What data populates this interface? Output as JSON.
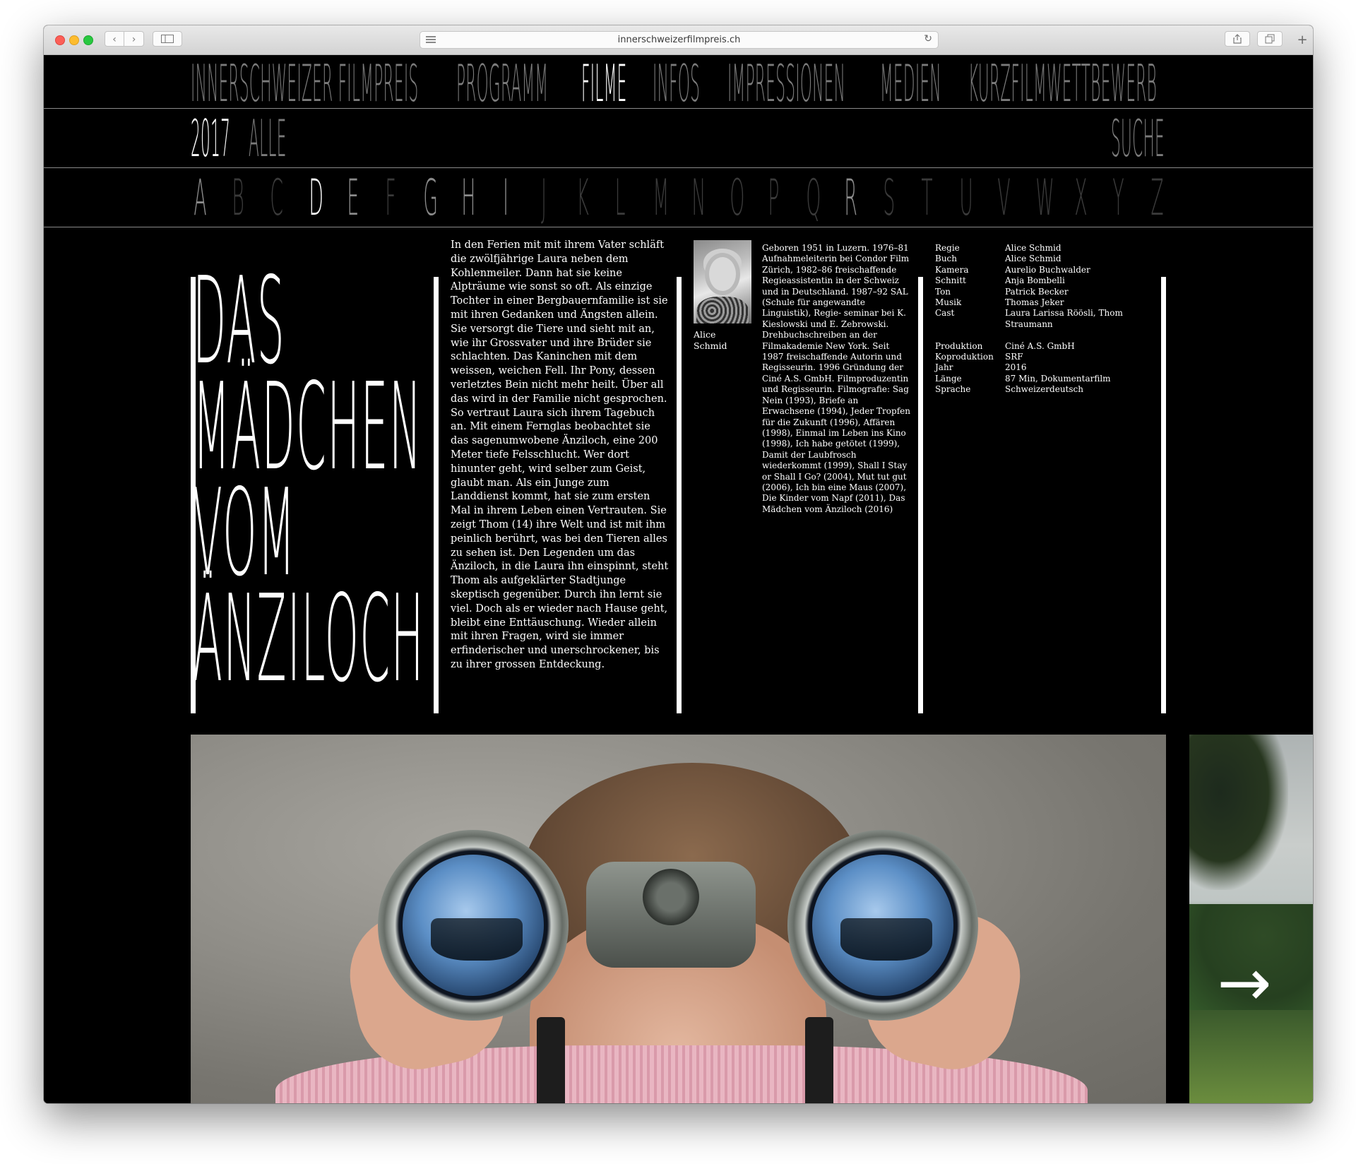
{
  "browser": {
    "url": "innerschweizerfilmpreis.ch",
    "back_icon": "chevron-left-icon",
    "forward_icon": "chevron-right-icon",
    "new_tab_label": "+"
  },
  "nav": {
    "items": [
      {
        "label": "INNERSCHWEIZER FILMPREIS",
        "active": false
      },
      {
        "label": "PROGRAMM",
        "active": false
      },
      {
        "label": "FILME",
        "active": true
      },
      {
        "label": "INFOS",
        "active": false
      },
      {
        "label": "IMPRESSIONEN",
        "active": false
      },
      {
        "label": "MEDIEN",
        "active": false
      },
      {
        "label": "KURZFILMWETTBEWERB",
        "active": false
      }
    ],
    "filter_year": "2017",
    "filter_all": "ALLE",
    "search": "SUCHE"
  },
  "alphabet": {
    "letters": [
      "A",
      "B",
      "C",
      "D",
      "E",
      "F",
      "G",
      "H",
      "I",
      "J",
      "K",
      "L",
      "M",
      "N",
      "O",
      "P",
      "Q",
      "R",
      "S",
      "T",
      "U",
      "V",
      "W",
      "X",
      "Y",
      "Z"
    ],
    "active": "D",
    "available": [
      "A",
      "D",
      "E",
      "G",
      "H",
      "I",
      "R"
    ]
  },
  "film": {
    "title_lines": [
      "DAS",
      "MÄDCHEN",
      "VOM",
      "ÄNZILOCH"
    ],
    "synopsis": "In den Ferien mit mit ihrem Vater schläft die zwölfjährige Laura neben dem Kohlenmeiler. Dann hat sie keine Alpträume wie sonst so oft. Als einzige Tochter in einer Bergbauernfamilie ist sie mit ihren Gedanken und Ängsten allein. Sie versorgt die Tiere und sieht mit an, wie ihr Grossvater und ihre Brüder sie schlachten. Das Kaninchen mit dem weissen, weichen Fell. Ihr Pony, dessen verletztes Bein nicht mehr heilt. Über all das wird in der Familie nicht gesprochen. So vertraut Laura sich ihrem Tagebuch an. Mit einem Fernglas beobachtet sie das sagenumwobene Änziloch, eine 200 Meter tiefe Felsschlucht. Wer dort hinunter geht, wird selber zum Geist, glaubt man. Als ein Junge zum Landdienst kommt, hat sie zum ersten Mal in ihrem Leben einen Vertrauten. Sie zeigt Thom (14) ihre Welt und ist mit ihm peinlich berührt, was bei den Tieren alles zu sehen ist. Den Legenden um das Änziloch, in die Laura ihn einspinnt, steht Thom als aufgeklärter Stadtjunge skeptisch gegenüber. Durch ihn lernt sie viel. Doch als er wieder nach Hause geht, bleibt eine Enttäuschung. Wieder allein mit ihren Fragen, wird sie immer erfinderischer und unerschrockener, bis zu ihrer grossen Entdeckung.",
    "director_name": "Alice Schmid",
    "director_bio": "Geboren 1951 in Luzern. 1976–81 Aufnahmeleiterin bei Condor Film Zürich, 1982–86 freischaffende Regieassistentin in der Schweiz und in Deutschland. 1987–92 SAL (Schule für angewandte Linguistik), Regie- seminar bei K. Kieslowski und E. Zebrowski. Drehbuchschreiben an der Filmakademie New York. Seit 1987 freischaffende Autorin und Regisseurin. 1996 Gründung der Ciné A.S. GmbH. Filmproduzentin und Regisseurin. Filmografie: Sag Nein (1993), Briefe an Erwachsene (1994), Jeder Tropfen für die Zukunft (1996), Affären (1998), Einmal im Leben ins Kino (1998), Ich habe getötet (1999), Damit der Laubfrosch wiederkommt (1999), Shall I Stay or Shall I Go? (2004), Mut tut gut (2006), Ich bin eine Maus (2007), Die Kinder vom Napf (2011), Das Mädchen vom Änziloch (2016)",
    "credits": [
      {
        "key": "Regie",
        "value": "Alice Schmid"
      },
      {
        "key": "Buch",
        "value": "Alice Schmid"
      },
      {
        "key": "Kamera",
        "value": "Aurelio Buchwalder"
      },
      {
        "key": "Schnitt",
        "value": "Anja Bombelli"
      },
      {
        "key": "Ton",
        "value": "Patrick Becker"
      },
      {
        "key": "Musik",
        "value": "Thomas Jeker"
      },
      {
        "key": "Cast",
        "value": "Laura Larissa Röösli, Thom Straumann"
      }
    ],
    "production": [
      {
        "key": "Produktion",
        "value": "Ciné A.S. GmbH"
      },
      {
        "key": "Koproduktion",
        "value": "SRF"
      },
      {
        "key": "Jahr",
        "value": "2016"
      },
      {
        "key": "Länge",
        "value": "87 Min, Dokumentarfilm"
      },
      {
        "key": "Sprache",
        "value": "Schweizerdeutsch"
      }
    ]
  },
  "gallery": {
    "next_arrow": "→"
  }
}
